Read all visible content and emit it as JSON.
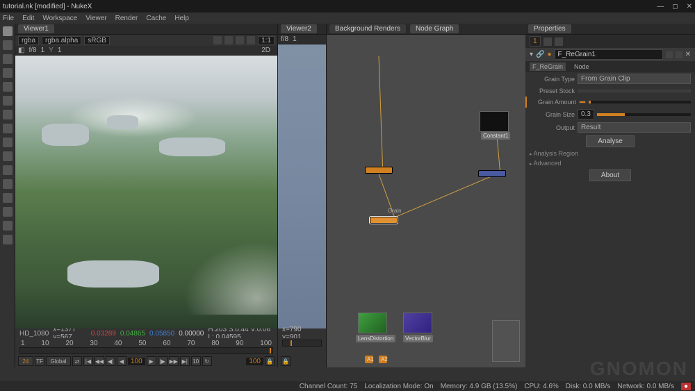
{
  "title": "tutorial.nk [modified] - NukeX",
  "menu": [
    "File",
    "Edit",
    "Workspace",
    "Viewer",
    "Render",
    "Cache",
    "Help"
  ],
  "viewer1": {
    "tab": "Viewer1",
    "channels": "rgba",
    "alpha": "rgba.alpha",
    "colorspace": "sRGB",
    "fstop": "f/8",
    "fval": "1",
    "yval": "1",
    "ratio": "1:1",
    "mode": "2D",
    "format": "HD_1080",
    "coords": "x=1377 y=567",
    "r": "0.03289",
    "g": "0.04865",
    "b": "0.05850",
    "a": "0.00000",
    "hsv": "H:203 S:0.44 V:0.06  L: 0.04595",
    "frames": [
      "1",
      "10",
      "20",
      "30",
      "40",
      "50",
      "60",
      "70",
      "80",
      "90",
      "100"
    ],
    "cur": "100",
    "fps": "24",
    "tf": "TF",
    "global": "Global",
    "step": "10",
    "end": "100"
  },
  "viewer2": {
    "tab": "Viewer2",
    "fstop": "f/8",
    "fval": "1",
    "coords": "x=790 y=901"
  },
  "panels": {
    "bg": "Background Renders",
    "ng": "Node Graph"
  },
  "nodes": {
    "constant": "Constant1",
    "regrain": "F_ReGrain1",
    "grain": "Grain",
    "a1": "A1",
    "a2": "A2",
    "ld": "LensDistortion",
    "vc": "VectorBlur"
  },
  "props": {
    "tab": "Properties",
    "count": "1",
    "nodename": "F_ReGrain1",
    "sub1": "F_ReGrain",
    "sub2": "Node",
    "grainType": {
      "lbl": "Grain Type",
      "val": "From Grain Clip"
    },
    "presetStock": {
      "lbl": "Preset Stock",
      "val": ""
    },
    "grainAmount": {
      "lbl": "Grain Amount",
      "val": ""
    },
    "grainSize": {
      "lbl": "Grain Size",
      "val": "0.3"
    },
    "output": {
      "lbl": "Output",
      "val": "Result"
    },
    "analyse": "Analyse",
    "region": "Analysis Region",
    "advanced": "Advanced",
    "about": "About"
  },
  "status": {
    "chan": "Channel Count: 75",
    "loc": "Localization Mode: On",
    "mem": "Memory: 4.9 GB (13.5%)",
    "cpu": "CPU: 4.6%",
    "disk": "Disk: 0.0 MB/s",
    "net": "Network: 0.0 MB/s"
  }
}
